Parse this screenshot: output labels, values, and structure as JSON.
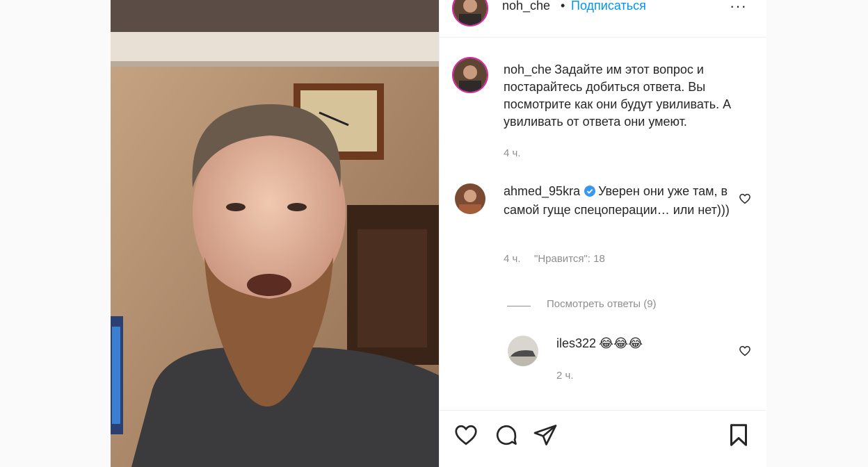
{
  "post": {
    "author": "noh_che",
    "separator": "•",
    "follow_label": "Подписаться",
    "more_label": "···",
    "caption_user": "noh_che",
    "caption_text": "Задайте им этот вопрос и постарайтесь добиться ответа. Вы посмотрите как они будут увиливать. А увиливать от ответа они умеют.",
    "caption_time": "4 ч."
  },
  "comments": [
    {
      "user": "ahmed_95kra",
      "verified": true,
      "text": "Уверен они уже там, в самой гуще спецоперации… или нет)))",
      "time": "4 ч.",
      "likes": "\"Нравится\": 18",
      "view_replies": "Посмотреть ответы (9)"
    },
    {
      "user": "iles322",
      "text": "😂😂😂",
      "time": "2 ч."
    }
  ],
  "actions": {
    "like": "heart-icon",
    "comment": "comment-icon",
    "share": "share-icon",
    "save": "bookmark-icon"
  },
  "colors": {
    "link": "#0095f6",
    "muted": "#8e8e8e",
    "text": "#262626",
    "verified": "#3897f0"
  }
}
